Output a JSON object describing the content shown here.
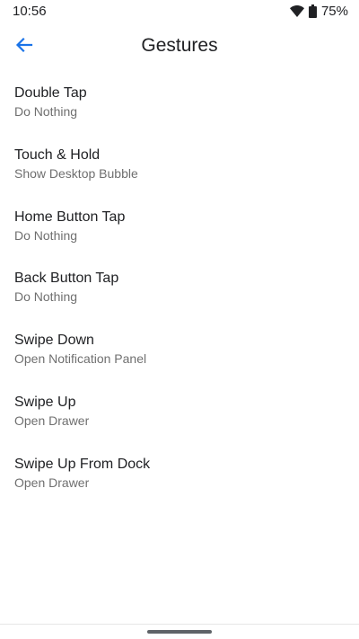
{
  "status_bar": {
    "time": "10:56",
    "battery": "75%",
    "icons": [
      "wifi-icon",
      "battery-icon"
    ]
  },
  "app_bar": {
    "back_icon": "arrow-back-icon",
    "title": "Gestures"
  },
  "gestures": [
    {
      "title": "Double Tap",
      "value": "Do Nothing"
    },
    {
      "title": "Touch & Hold",
      "value": "Show Desktop Bubble"
    },
    {
      "title": "Home Button Tap",
      "value": "Do Nothing"
    },
    {
      "title": "Back Button Tap",
      "value": "Do Nothing"
    },
    {
      "title": "Swipe Down",
      "value": "Open Notification Panel"
    },
    {
      "title": "Swipe Up",
      "value": "Open Drawer"
    },
    {
      "title": "Swipe Up From Dock",
      "value": "Open Drawer"
    }
  ],
  "colors": {
    "accent": "#1a73e8",
    "text_primary": "#202124",
    "text_secondary": "#6f6f6f",
    "background": "#ffffff"
  }
}
